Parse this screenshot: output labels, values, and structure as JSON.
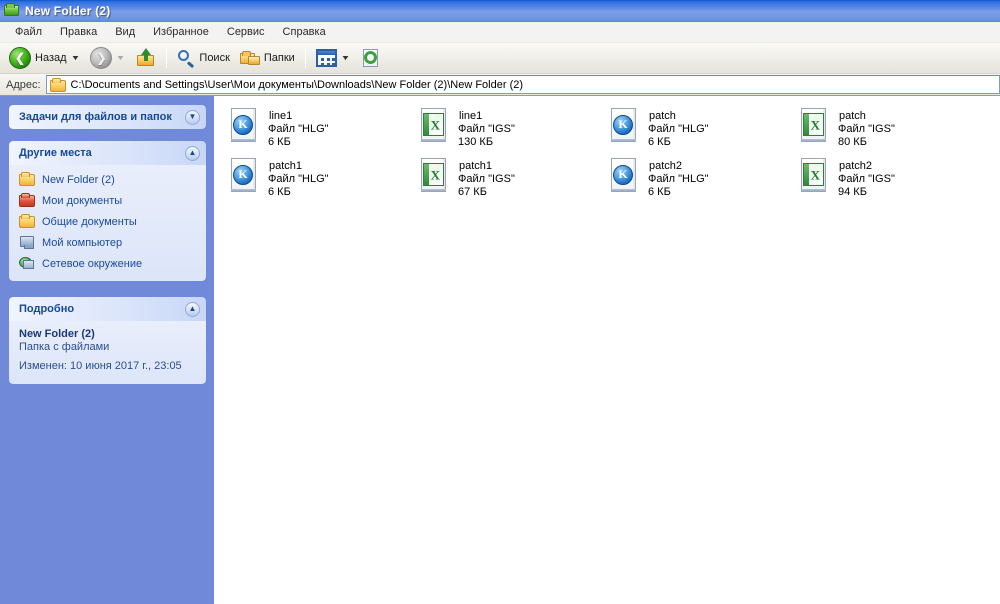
{
  "window": {
    "title": "New Folder (2)",
    "title_icon": "folder-icon"
  },
  "menubar": {
    "items": [
      {
        "label": "Файл"
      },
      {
        "label": "Правка"
      },
      {
        "label": "Вид"
      },
      {
        "label": "Избранное"
      },
      {
        "label": "Сервис"
      },
      {
        "label": "Справка"
      }
    ]
  },
  "toolbar": {
    "back_label": "Назад",
    "search_label": "Поиск",
    "folders_label": "Папки",
    "back_icon": "back-arrow-icon",
    "forward_icon": "forward-arrow-icon",
    "up_icon": "up-folder-icon",
    "search_icon": "search-icon",
    "folders_icon": "folders-icon",
    "views_icon": "views-icon",
    "refresh_icon": "refresh-icon"
  },
  "address": {
    "label": "Адрес:",
    "path": "C:\\Documents and Settings\\User\\Мои документы\\Downloads\\New Folder (2)\\New Folder (2)",
    "icon": "folder-icon"
  },
  "sidebar": {
    "tasks_panel": {
      "title": "Задачи для файлов и папок",
      "collapsed": true,
      "chevron": "chevron-down-icon"
    },
    "places_panel": {
      "title": "Другие места",
      "chevron": "chevron-up-icon",
      "items": [
        {
          "label": "New Folder (2)",
          "icon": "folder-yellow-icon"
        },
        {
          "label": "Мои документы",
          "icon": "folder-red-icon"
        },
        {
          "label": "Общие документы",
          "icon": "folder-yellow-icon"
        },
        {
          "label": "Мой компьютер",
          "icon": "computer-icon"
        },
        {
          "label": "Сетевое окружение",
          "icon": "network-icon"
        }
      ]
    },
    "details_panel": {
      "title": "Подробно",
      "chevron": "chevron-up-icon",
      "name": "New Folder (2)",
      "kind": "Папка с файлами",
      "modified": "Изменен: 10 июня 2017 г., 23:05"
    }
  },
  "files": [
    {
      "name": "line1",
      "kind": "Файл \"HLG\"",
      "size": "6 КБ",
      "icon": "hlg-file-icon",
      "glyph": "K"
    },
    {
      "name": "line1",
      "kind": "Файл \"IGS\"",
      "size": "130 КБ",
      "icon": "igs-file-icon",
      "glyph": "X"
    },
    {
      "name": "patch",
      "kind": "Файл \"HLG\"",
      "size": "6 КБ",
      "icon": "hlg-file-icon",
      "glyph": "K"
    },
    {
      "name": "patch",
      "kind": "Файл \"IGS\"",
      "size": "80 КБ",
      "icon": "igs-file-icon",
      "glyph": "X"
    },
    {
      "name": "patch1",
      "kind": "Файл \"HLG\"",
      "size": "6 КБ",
      "icon": "hlg-file-icon",
      "glyph": "K"
    },
    {
      "name": "patch1",
      "kind": "Файл \"IGS\"",
      "size": "67 КБ",
      "icon": "igs-file-icon",
      "glyph": "X"
    },
    {
      "name": "patch2",
      "kind": "Файл \"HLG\"",
      "size": "6 КБ",
      "icon": "hlg-file-icon",
      "glyph": "K"
    },
    {
      "name": "patch2",
      "kind": "Файл \"IGS\"",
      "size": "94 КБ",
      "icon": "igs-file-icon",
      "glyph": "X"
    }
  ],
  "colors": {
    "titlebar_blue": "#2f6fe0",
    "sidebar_blue": "#7089d9",
    "panel_header": "#dae4fa",
    "link_blue": "#1b4b9c",
    "panel_title": "#13499a"
  }
}
